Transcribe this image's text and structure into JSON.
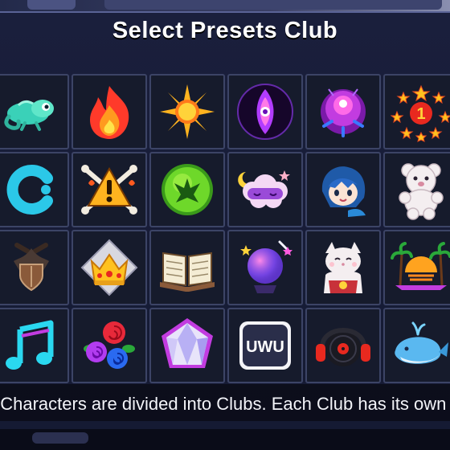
{
  "dialog": {
    "title": "Select Presets Club",
    "caption": "t Characters are divided into Clubs. Each Club has its own ther"
  },
  "clubs": [
    {
      "icon": "chameleon-icon"
    },
    {
      "icon": "flame-icon"
    },
    {
      "icon": "sun-icon"
    },
    {
      "icon": "mystic-eye-icon"
    },
    {
      "icon": "magic-orb-icon"
    },
    {
      "icon": "first-place-stars-icon"
    },
    {
      "icon": "c-logo-icon"
    },
    {
      "icon": "danger-warning-icon"
    },
    {
      "icon": "dragon-emblem-icon"
    },
    {
      "icon": "sleep-mask-cloud-icon"
    },
    {
      "icon": "anime-girl-icon"
    },
    {
      "icon": "teddy-bear-icon"
    },
    {
      "icon": "shield-icon"
    },
    {
      "icon": "crown-icon"
    },
    {
      "icon": "open-book-icon"
    },
    {
      "icon": "crystal-ball-icon"
    },
    {
      "icon": "lucky-cat-icon"
    },
    {
      "icon": "sunset-palms-icon"
    },
    {
      "icon": "music-notes-icon"
    },
    {
      "icon": "roses-icon"
    },
    {
      "icon": "crystal-gem-icon"
    },
    {
      "icon": "uwu-badge-icon"
    },
    {
      "icon": "headphones-record-icon"
    },
    {
      "icon": "whale-icon"
    }
  ],
  "uwu_text": "UWU",
  "colors": {
    "panel": "#1a1f3c",
    "cell_bg": "#161b2c",
    "cell_border": "#3c4466",
    "title": "#ffffff"
  }
}
